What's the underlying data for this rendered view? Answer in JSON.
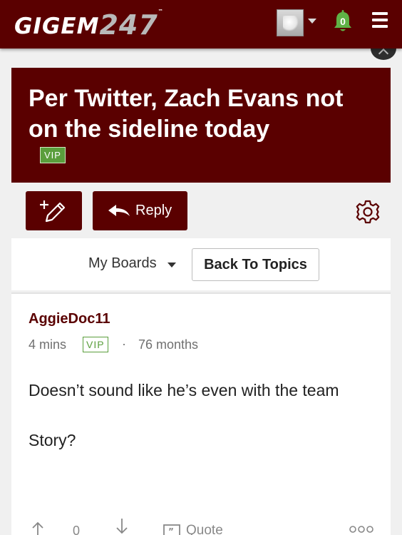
{
  "header": {
    "logo_text": "GIGEM",
    "logo_number": "247",
    "logo_tm": "™",
    "notification_count": "0"
  },
  "thread": {
    "title": "Per Twitter, Zach Evans not on the sideline today",
    "badge": "VIP"
  },
  "actions": {
    "reply_label": "Reply"
  },
  "board_nav": {
    "my_boards_label": "My Boards",
    "back_to_topics_label": "Back To Topics"
  },
  "post": {
    "author": "AggieDoc11",
    "time_ago": "4 mins",
    "badge": "VIP",
    "separator": "·",
    "tenure": "76 months",
    "body_line1": "Doesn’t sound like he’s even with the team",
    "body_line2": "Story?",
    "vote_count": "0",
    "quote_label": "Quote"
  },
  "colors": {
    "brand_maroon": "#5a0000",
    "vip_green": "#5a9e3c",
    "notification_green": "#5fb246"
  }
}
